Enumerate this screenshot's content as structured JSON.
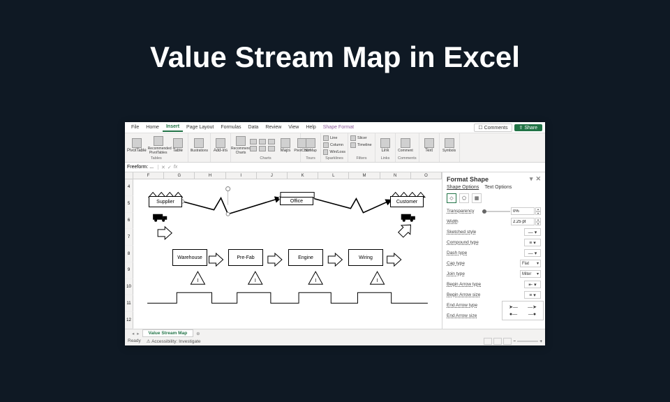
{
  "slide": {
    "title": "Value Stream Map in Excel"
  },
  "menu": {
    "tabs": [
      "File",
      "Home",
      "Insert",
      "Page Layout",
      "Formulas",
      "Data",
      "Review",
      "View",
      "Help",
      "Shape Format"
    ],
    "active": "Insert",
    "context": "Shape Format",
    "comments": "Comments",
    "share": "Share"
  },
  "ribbon": {
    "groups": [
      {
        "label": "Tables",
        "items": [
          "PivotTable",
          "Recommended PivotTables",
          "Table"
        ]
      },
      {
        "label": "Illustrations",
        "items": [
          "Illustrations"
        ]
      },
      {
        "label": "Add-ins",
        "items": [
          "Add-ins"
        ]
      },
      {
        "label": "Charts",
        "items": [
          "Recommended Charts",
          "",
          "",
          "",
          "",
          "",
          "Maps",
          "PivotChart"
        ]
      },
      {
        "label": "Tours",
        "items": [
          "3D Map"
        ]
      },
      {
        "label": "Sparklines",
        "items": [
          "Line",
          "Column",
          "Win/Loss"
        ]
      },
      {
        "label": "Filters",
        "items": [
          "Slicer",
          "Timeline"
        ]
      },
      {
        "label": "Links",
        "items": [
          "Link"
        ]
      },
      {
        "label": "Comments",
        "items": [
          "Comment"
        ]
      },
      {
        "label": "Text",
        "items": [
          "Text"
        ]
      },
      {
        "label": "Symbols",
        "items": [
          "Symbols"
        ]
      }
    ]
  },
  "formula": {
    "namebox": "Freeform: ...",
    "fx": "fx"
  },
  "columns": [
    "F",
    "G",
    "H",
    "I",
    "J",
    "K",
    "L",
    "M",
    "N",
    "O"
  ],
  "rows": [
    "4",
    "5",
    "6",
    "7",
    "8",
    "9",
    "10",
    "11",
    "12"
  ],
  "vsm": {
    "supplier": "Supplier",
    "office": "Office",
    "customer": "Customer",
    "warehouse": "Warehouse",
    "prefab": "Pre-Fab",
    "engine": "Engine",
    "wiring": "Wiring",
    "inventory": "I"
  },
  "pane": {
    "title": "Format Shape",
    "tab1": "Shape Options",
    "tab2": "Text Options",
    "transparency": {
      "label": "Transparency",
      "value": "0%"
    },
    "width": {
      "label": "Width",
      "value": "2.25 pt"
    },
    "sketched": {
      "label": "Sketched style"
    },
    "compound": {
      "label": "Compound type"
    },
    "dash": {
      "label": "Dash type"
    },
    "cap": {
      "label": "Cap type",
      "value": "Flat"
    },
    "join": {
      "label": "Join type",
      "value": "Miter"
    },
    "beginArrow": {
      "label": "Begin Arrow type"
    },
    "beginSize": {
      "label": "Begin Arrow size"
    },
    "endArrow": {
      "label": "End Arrow type"
    },
    "endSize": {
      "label": "End Arrow size"
    }
  },
  "status": {
    "sheet": "Value Stream Map",
    "ready": "Ready",
    "accessibility": "Accessibility: Investigate"
  }
}
